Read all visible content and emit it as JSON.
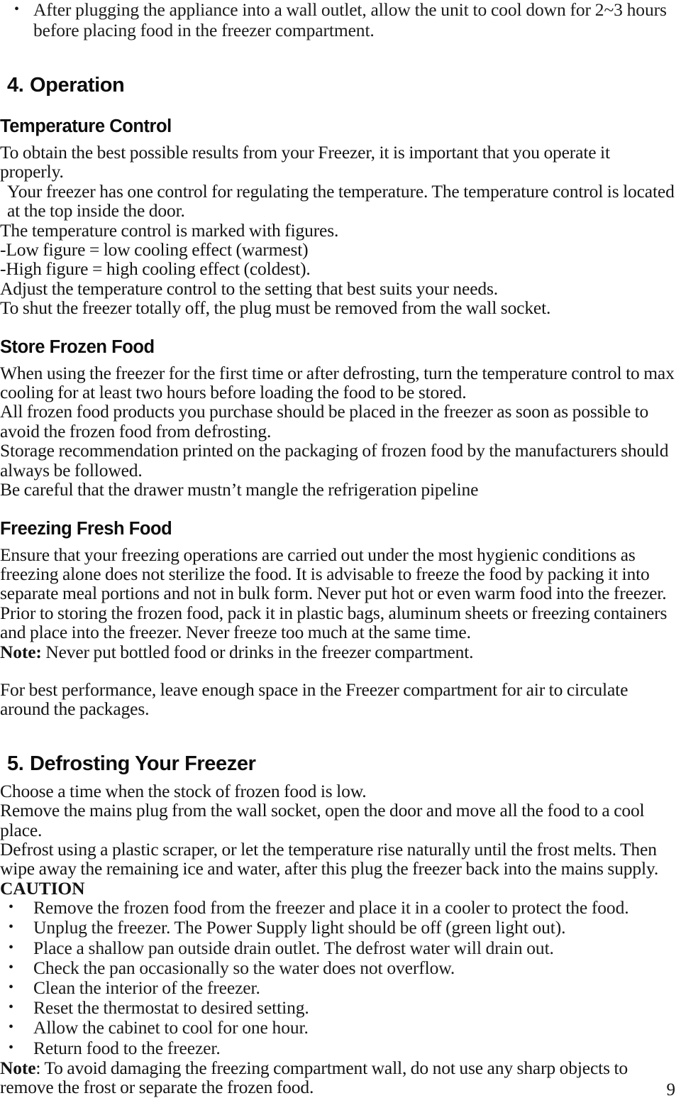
{
  "page": {
    "number": "9"
  },
  "top_bullet": {
    "marker": "•",
    "text": "After plugging the appliance into a wall outlet, allow the unit to cool down for 2~3 hours before placing food in the freezer compartment."
  },
  "section_operation": {
    "number": "4.",
    "title": "Operation",
    "temperature_control": {
      "heading": "Temperature Control",
      "lines": [
        "To obtain the best possible results from your Freezer, it is important that you operate it properly.",
        "Your freezer has one control for regulating the temperature. The temperature control is located at the top inside the door.",
        "The temperature control is marked with figures.",
        "-Low figure = low cooling effect (warmest)",
        "-High figure = high cooling effect (coldest).",
        "Adjust the temperature control to the setting that best suits your needs.",
        "To shut the freezer totally off, the plug must be removed from the wall socket."
      ]
    },
    "store_frozen_food": {
      "heading": "Store Frozen Food",
      "lines": [
        "When using the freezer for the first time or after defrosting, turn the temperature control to max cooling for at least two hours before loading the food to be stored.",
        "All frozen food products you purchase should be placed in the freezer as soon as possible to avoid the frozen food from defrosting.",
        "Storage recommendation printed on the packaging of frozen food by the manufacturers should always be followed.",
        "Be careful that the drawer mustn’t mangle the refrigeration pipeline"
      ]
    },
    "freezing_fresh_food": {
      "heading": "Freezing Fresh Food",
      "paragraph": "Ensure that your freezing operations are carried out under the most hygienic conditions as freezing alone does not sterilize the food. It is advisable to freeze the food by packing it into separate meal portions and not in bulk form. Never put hot or even warm food into the freezer. Prior to storing the frozen food, pack it in plastic bags, aluminum sheets or freezing containers and place into the freezer. Never freeze too much at the same time.",
      "note_label": "Note:",
      "note_text": " Never put bottled food or drinks in the freezer compartment.",
      "closing": "For best performance, leave enough space in the Freezer compartment for air to circulate around the packages."
    }
  },
  "section_defrosting": {
    "number": "5.",
    "title": "Defrosting Your Freezer",
    "lines": [
      "Choose a time when the stock of frozen food is low.",
      "Remove the mains plug from the wall socket, open the door and move all the food to a cool place.",
      "Defrost using a plastic scraper, or let the temperature rise naturally until the frost melts. Then wipe away the remaining ice and water, after this plug the freezer back into the mains supply."
    ],
    "caution_label": "CAUTION",
    "bullet_marker": "•",
    "caution_items": [
      "Remove the frozen food from the freezer and place it in a cooler to protect the food.",
      "Unplug the freezer. The Power Supply light should be off (green light out).",
      "Place a shallow pan outside drain outlet.  The defrost water will drain out.",
      "Check the pan occasionally so the water does not overflow.",
      "Clean the interior of the freezer.",
      "Reset the thermostat to desired setting.",
      "Allow the cabinet to cool for one hour.",
      "Return food to the freezer."
    ],
    "note_label": "Note",
    "note_text": ": To avoid damaging the freezing compartment wall, do not use any sharp objects to remove the frost or separate the frozen food."
  }
}
